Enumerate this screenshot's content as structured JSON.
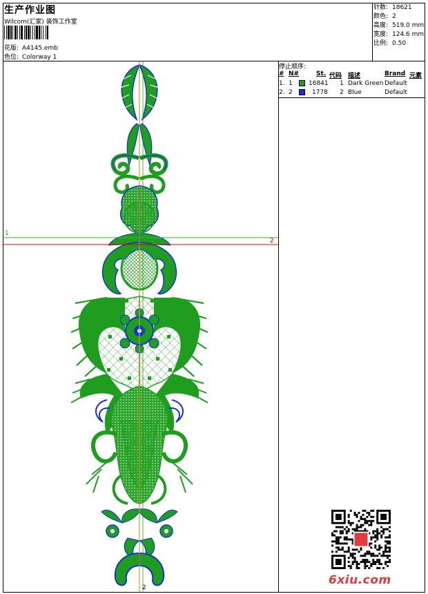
{
  "title": "生产作业图",
  "studio": "Wilcom(汇家) 装饰工作室",
  "meta": [
    {
      "label": "花版:",
      "value": "A4145.emb"
    },
    {
      "label": "色位:",
      "value": "Colorway 1"
    }
  ],
  "stats": [
    {
      "label": "针数:",
      "value": "18621"
    },
    {
      "label": "颜色:",
      "value": "2"
    },
    {
      "label": "高度:",
      "value": "519.0 mm"
    },
    {
      "label": "宽度:",
      "value": "124.6 mm"
    },
    {
      "label": "比例:",
      "value": "0.50"
    }
  ],
  "stop_sequence": {
    "title": "停止顺序:",
    "headers": [
      "#",
      "N#",
      "St.",
      "代码",
      "描述",
      "Brand",
      "元素"
    ],
    "rows": [
      {
        "index": "1.",
        "n": "1",
        "color": "#1f9d1f",
        "stitches": "16841",
        "code": "1",
        "desc": "Dark Green",
        "brand": "Default"
      },
      {
        "index": "2.",
        "n": "2",
        "color": "#1030e0",
        "stitches": "1778",
        "code": "2",
        "desc": "Blue",
        "brand": "Default"
      }
    ]
  },
  "markers": {
    "green_line_label": "1",
    "red_line_label": "2",
    "end_label": "2"
  },
  "watermark": "6xiu.com",
  "colors": {
    "green": "#1f9d1f",
    "blue": "#1030e0",
    "red": "#e00000",
    "axis": "#c8a020"
  }
}
